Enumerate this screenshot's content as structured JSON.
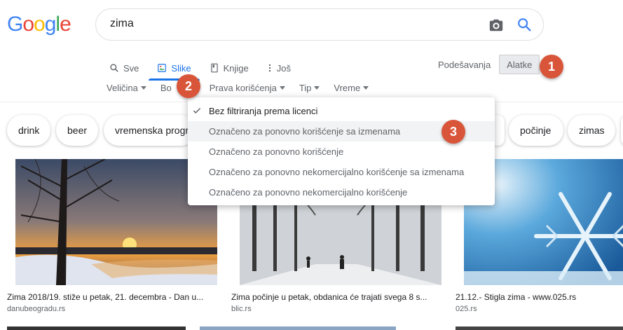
{
  "logo": {
    "text": "Google",
    "letters": [
      "G",
      "o",
      "o",
      "g",
      "l",
      "e"
    ],
    "colors": [
      "#4285F4",
      "#EA4335",
      "#FBBC05",
      "#4285F4",
      "#34A853",
      "#EA4335"
    ]
  },
  "search": {
    "value": "zima"
  },
  "tabs": [
    {
      "label": "Sve",
      "icon": "search-icon"
    },
    {
      "label": "Slike",
      "icon": "image-icon"
    },
    {
      "label": "Knjige",
      "icon": "book-icon"
    },
    {
      "label": "Još",
      "icon": "more-vert-icon"
    }
  ],
  "settings_label": "Podešavanja",
  "tools_label": "Alatke",
  "toolbar": [
    {
      "label": "Veličina"
    },
    {
      "label": "Bo"
    },
    {
      "label": "Prava korišćenja"
    },
    {
      "label": "Tip"
    },
    {
      "label": "Vreme"
    }
  ],
  "chips": [
    "drink",
    "beer",
    "vremenska progr",
    "počinje",
    "zimas"
  ],
  "results": [
    {
      "caption": "Zima 2018/19. stiže u petak, 21. decembra - Dan u...",
      "source": "danubeogradu.rs"
    },
    {
      "caption": "Zima počinje u petak, obdanica će trajati svega 8 s...",
      "source": "blic.rs"
    },
    {
      "caption": "21.12.- Stigla zima - www.025.rs",
      "source": "025.rs"
    }
  ],
  "dropdown": [
    {
      "label": "Bez filtriranja prema licenci",
      "selected": true
    },
    {
      "label": "Označeno za ponovno korišćenje sa izmenama"
    },
    {
      "label": "Označeno za ponovno korišćenje"
    },
    {
      "label": "Označeno za ponovno nekomercijalno korišćenje sa izmenama"
    },
    {
      "label": "Označeno za ponovno nekomercijalno korišćenje"
    }
  ],
  "badges": [
    "1",
    "2",
    "3"
  ],
  "colors": {
    "accent": "#1a73e8",
    "badge": "#d9553a"
  }
}
